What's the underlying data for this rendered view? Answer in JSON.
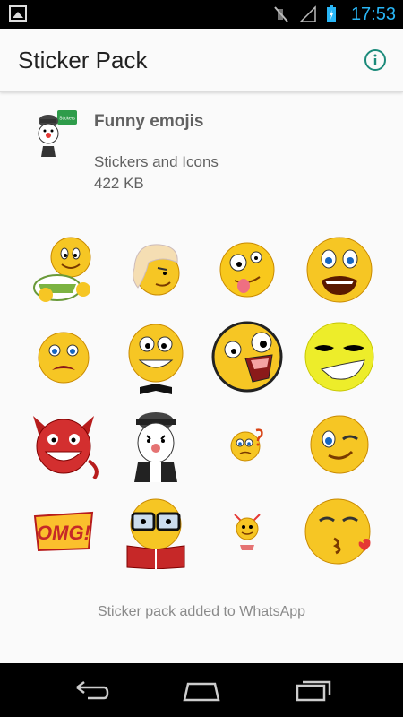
{
  "status_bar": {
    "time": "17:53"
  },
  "app_bar": {
    "title": "Sticker Pack"
  },
  "pack": {
    "name": "Funny emojis",
    "publisher": "Stickers and Icons",
    "size": "422 KB",
    "icon_badge": "Stickers"
  },
  "stickers": {
    "omg_text": "OMG!"
  },
  "footer": {
    "status": "Sticker pack added to WhatsApp"
  },
  "colors": {
    "accent": "#1b8a7a",
    "status_time": "#29b6f6"
  }
}
